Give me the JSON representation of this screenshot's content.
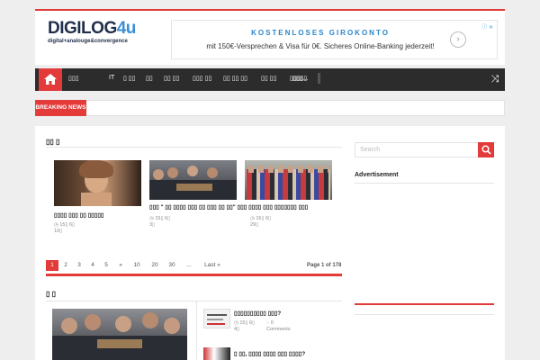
{
  "header": {
    "logo_main": "DIGILOG",
    "logo_accent": "4u",
    "logo_tag": "digital+analouge&convergence"
  },
  "ad_banner": {
    "title": "KOSTENLOSES GIROKONTO",
    "text": "mit 150€-Versprechen & Visa für 0€. Sicheres Online-Banking jederzeit!",
    "arrow": "›"
  },
  "nav": {
    "items": [
      "▯▯▯",
      "IT",
      "▯ ▯▯",
      "▯▯",
      "▯▯ ▯▯",
      "▯▯▯ ▯▯",
      "▯▯ ▯▯ ▯▯",
      "▯▯ ▯▯",
      "▯▯▯▯▯",
      "▯▯▯..."
    ],
    "shuffle_icon": "shuffle-icon"
  },
  "breaking": {
    "label": "BREAKING NEWS"
  },
  "block1": {
    "title": "▯▯ ▯",
    "posts": [
      {
        "title": "▯▯▯▯ ▯▯▯ ▯▯ ▯▯▯▯▯",
        "date": "◷ 15▯ 6▯",
        "views": "10▯"
      },
      {
        "title": "▯▯▯ \" ▯▯ ▯▯▯▯ ▯▯▯ ▯▯ ▯▯▯ ▯▯ ▯▯\" ▯▯▯ ▯▯▯▯ ▯▯▯ ▯▯▯▯▯▯▯ ▯▯▯",
        "date": "◷ 15▯ 6▯",
        "views": "3▯"
      },
      {
        "title": "",
        "date": "◷ 15▯ 6▯",
        "views": "29▯"
      }
    ],
    "pager": [
      "1",
      "2",
      "3",
      "4",
      "5",
      "»",
      "10",
      "20",
      "30",
      "...",
      "Last »"
    ],
    "page_info": "Page 1 of 178"
  },
  "block2": {
    "title": "▯ ▯",
    "side_posts": [
      {
        "title": "▯▯▯▯▯▯▯▯▯▯ ▯▯▯?",
        "date": "◷ 15▯ 6▯",
        "comments": "◌ 0",
        "comments_label": "Comments",
        "views": "4▯"
      },
      {
        "title": "▯ ▯▯, ▯▯▯▯ ▯▯▯▯ ▯▯▯ ▯▯▯▯?"
      }
    ]
  },
  "sidebar": {
    "search_placeholder": "Search",
    "ad_title": "Advertisement"
  },
  "colors": {
    "accent": "#e33a3a",
    "nav_bg": "#2c2c2c",
    "logo": "#1f2e4a",
    "logo_accent": "#3a8fd6"
  }
}
